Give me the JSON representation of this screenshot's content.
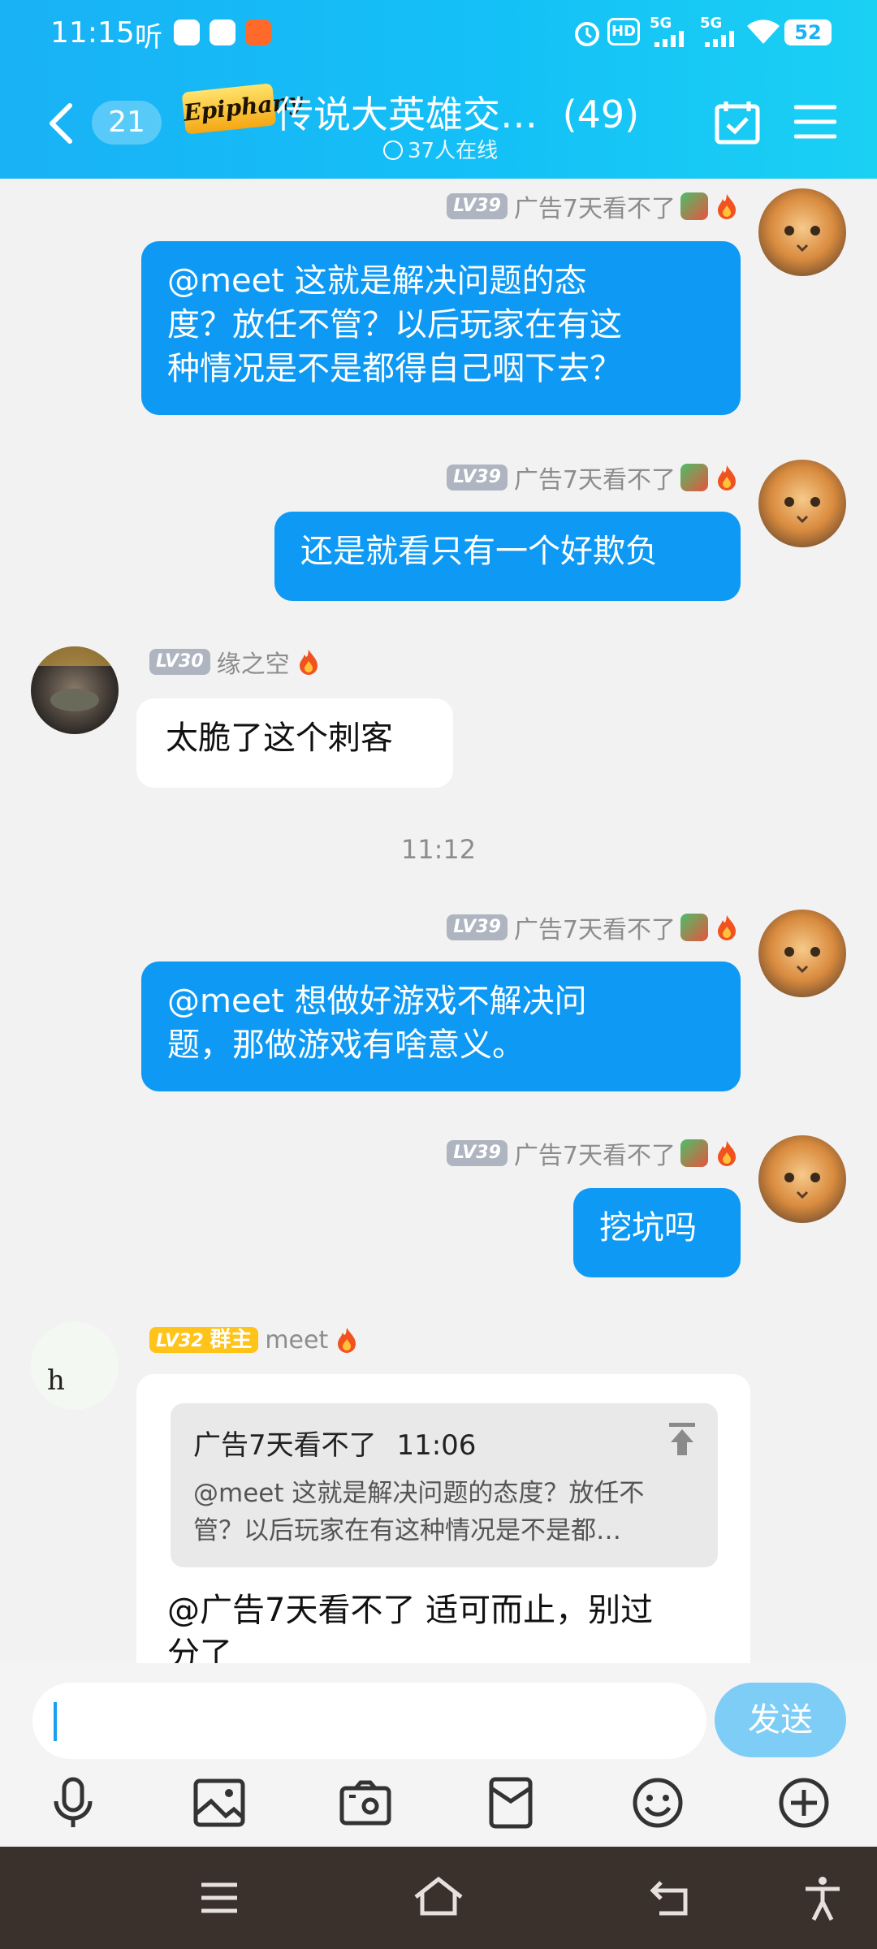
{
  "status_bar": {
    "time": "11:15",
    "listen": "听",
    "hd": "HD",
    "net1": "5G",
    "net2": "5G",
    "battery": "52"
  },
  "header": {
    "unread_count": "21",
    "logo_text": "Epiphany",
    "group_title": "传说大英雄交…",
    "member_count": "(49)",
    "online": "37人在线"
  },
  "messages": [
    {
      "side": "out",
      "level": "LV39",
      "name": "广告7天看不了",
      "lines": [
        "@meet  这就是解决问题的态",
        "度？放任不管？以后玩家在有这",
        "种情况是不是都得自己咽下去？"
      ]
    },
    {
      "side": "out",
      "level": "LV39",
      "name": "广告7天看不了",
      "lines": [
        "还是就看只有一个好欺负"
      ]
    },
    {
      "side": "in",
      "level": "LV30",
      "name": "缘之空",
      "lines": [
        "太脆了这个刺客"
      ]
    },
    {
      "side": "out",
      "level": "LV39",
      "name": "广告7天看不了",
      "lines": [
        "@meet  想做好游戏不解决问",
        "题，那做游戏有啥意义。"
      ]
    },
    {
      "side": "out",
      "level": "LV39",
      "name": "广告7天看不了",
      "lines": [
        "挖坑吗"
      ]
    },
    {
      "side": "in",
      "level": "LV32",
      "role": "群主",
      "name": "meet",
      "avatar_letter": "h",
      "quote": {
        "author": "广告7天看不了",
        "time": "11:06",
        "lines": [
          "@meet  这就是解决问题的态度？放任不",
          "管？以后玩家在有这种情况是不是都…"
        ]
      },
      "lines": [
        "@广告7天看不了  适可而止，别过",
        "分了"
      ]
    }
  ],
  "timestamp": "11:12",
  "input": {
    "placeholder": "",
    "send_label": "发送"
  },
  "toolbar": [
    "microphone-icon",
    "image-icon",
    "camera-icon",
    "red-packet-icon",
    "emoji-icon",
    "plus-icon"
  ],
  "nav": [
    "menu-icon",
    "home-icon",
    "back-icon",
    "accessibility-icon"
  ],
  "colors": {
    "header": "#19b2f5",
    "bubble_out": "#0d99f4",
    "send_button": "#7ecdf7"
  }
}
